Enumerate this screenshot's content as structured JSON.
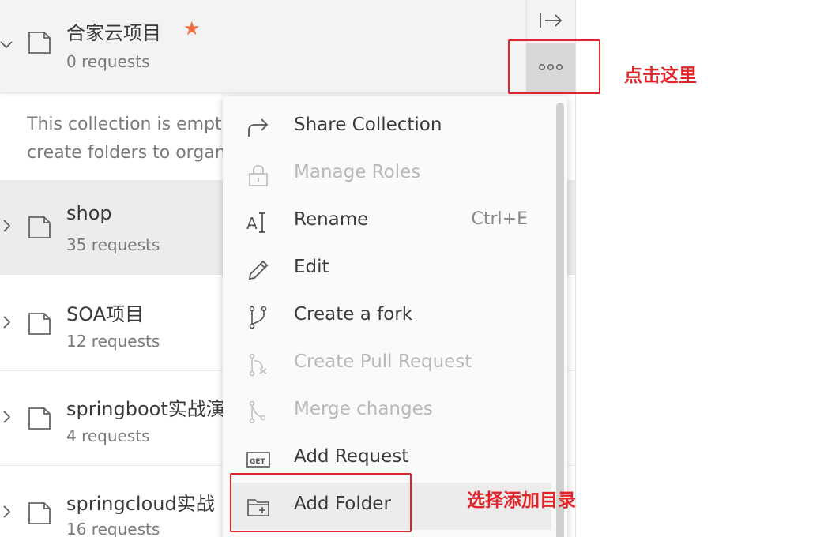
{
  "collections": [
    {
      "name": "合家云项目",
      "count": "0 requests",
      "starred": true,
      "expanded": true
    },
    {
      "name": "shop",
      "count": "35 requests"
    },
    {
      "name": "SOA项目",
      "count": "12 requests"
    },
    {
      "name": "springboot实战演",
      "count": "4 requests"
    },
    {
      "name": "springcloud实战",
      "count": "16 requests"
    }
  ],
  "star_glyph": "★",
  "empty_message": {
    "line1": "This collection is empt",
    "line2": "create folders to organ"
  },
  "menu": {
    "items": [
      {
        "label": "Share Collection",
        "icon": "share-icon",
        "enabled": true
      },
      {
        "label": "Manage Roles",
        "icon": "lock-icon",
        "enabled": false
      },
      {
        "label": "Rename",
        "icon": "rename-icon",
        "enabled": true,
        "shortcut": "Ctrl+E"
      },
      {
        "label": "Edit",
        "icon": "pencil-icon",
        "enabled": true
      },
      {
        "label": "Create a fork",
        "icon": "fork-icon",
        "enabled": true
      },
      {
        "label": "Create Pull Request",
        "icon": "pull-request-icon",
        "enabled": false
      },
      {
        "label": "Merge changes",
        "icon": "merge-icon",
        "enabled": false
      },
      {
        "label": "Add Request",
        "icon": "get-request-icon",
        "enabled": true
      },
      {
        "label": "Add Folder",
        "icon": "add-folder-icon",
        "enabled": true,
        "hovered": true
      }
    ]
  },
  "annotations": {
    "click_here": "点击这里",
    "select_add_folder": "选择添加目录"
  },
  "colors": {
    "annotation_red": "#e0262b",
    "star_orange": "#f26b3a",
    "selected_row_bg": "#ececec"
  }
}
